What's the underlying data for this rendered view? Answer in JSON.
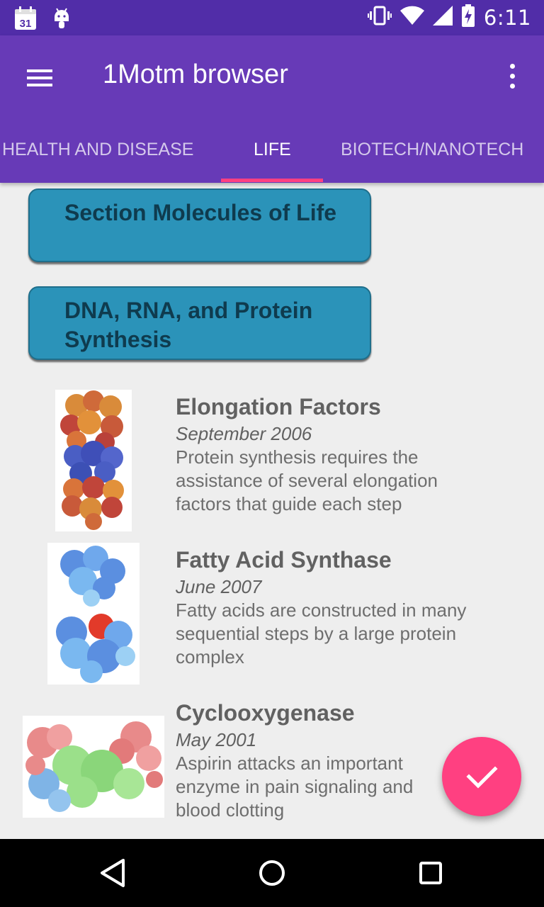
{
  "status_bar": {
    "time": "6:11",
    "calendar_day": "31",
    "icons": [
      "calendar-icon",
      "android-icon",
      "vibrate-icon",
      "wifi-icon",
      "signal-icon",
      "battery-charging-icon"
    ]
  },
  "app_bar": {
    "title": "1Motm browser",
    "menu_icon": "hamburger-menu-icon",
    "overflow_icon": "more-vert-icon"
  },
  "tabs": [
    {
      "label": "HEALTH AND DISEASE",
      "active": false
    },
    {
      "label": "LIFE",
      "active": true
    },
    {
      "label": "BIOTECH/NANOTECH",
      "active": false
    }
  ],
  "sections": [
    {
      "label": "Section Molecules of Life"
    },
    {
      "label": "DNA, RNA, and Protein Synthesis"
    }
  ],
  "items": [
    {
      "title": "Elongation Factors",
      "date": "September 2006",
      "description": "Protein synthesis requires the assistance of several elongation factors that guide each step"
    },
    {
      "title": "Fatty Acid Synthase",
      "date": "June 2007",
      "description": "Fatty acids are constructed in many sequential steps by a large protein complex"
    },
    {
      "title": "Cyclooxygenase",
      "date": "May 2001",
      "description": "Aspirin attacks an important enzyme in pain signaling and blood clotting"
    }
  ],
  "fab": {
    "icon": "check-icon"
  },
  "nav_bar": {
    "icons": [
      "back-icon",
      "home-icon",
      "recents-icon"
    ]
  },
  "colors": {
    "status_bar": "#512da8",
    "app_bar": "#673ab7",
    "accent": "#ff4081",
    "section_button": "#2b93b9"
  }
}
